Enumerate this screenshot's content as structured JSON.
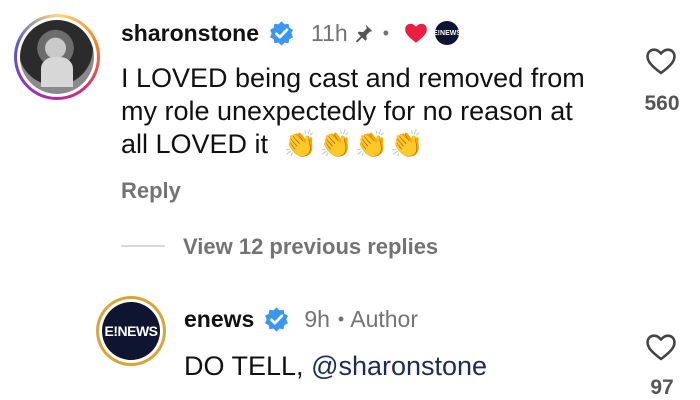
{
  "comment": {
    "username": "sharonstone",
    "time": "11h",
    "text_line1": "I LOVED being cast and removed from",
    "text_line2": "my role unexpectedly for no reason at",
    "text_line3": "all LOVED it",
    "emoji": "👏👏👏👏",
    "reply_label": "Reply",
    "like_count": "560",
    "liked_by_author_badge": "E!NEWS"
  },
  "view_previous_replies": "View 12 previous replies",
  "reply": {
    "username": "enews",
    "time": "9h",
    "role": "Author",
    "text": "DO TELL, ",
    "mention": "@sharonstone",
    "like_count": "97",
    "avatar_text": "E!NEWS"
  },
  "colors": {
    "verified": "#3897f0",
    "heart": "#ed1c40",
    "enews_navy": "#0f1530",
    "enews_gold": "#d9a53a"
  },
  "icons": [
    "verified-badge-icon",
    "pin-icon",
    "heart-icon",
    "heart-outline-icon"
  ]
}
